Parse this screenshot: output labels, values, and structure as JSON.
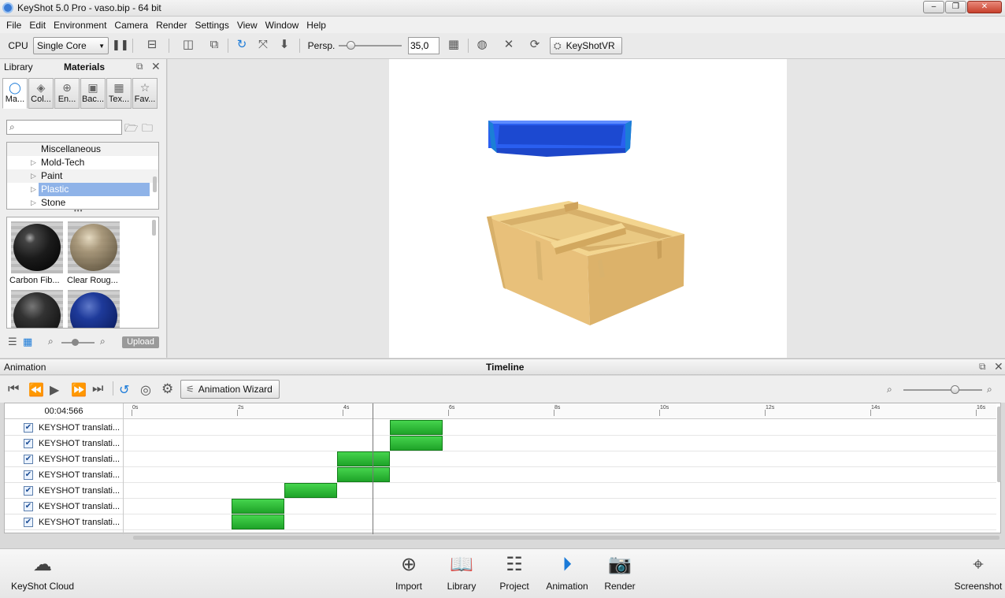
{
  "window": {
    "title": "KeyShot 5.0 Pro  - vaso.bip  - 64 bit",
    "minimize": "–",
    "maximize": "❐",
    "close": "✕"
  },
  "menu": [
    "File",
    "Edit",
    "Environment",
    "Camera",
    "Render",
    "Settings",
    "View",
    "Window",
    "Help"
  ],
  "toolbar": {
    "cpu_label": "CPU",
    "cpu_mode": "Single Core",
    "pause": "❚❚",
    "persp_label": "Persp.",
    "focal_value": "35,0",
    "vr_label": "KeyShotVR"
  },
  "library": {
    "header_left": "Library",
    "header_title": "Materials",
    "tabs": [
      {
        "label": "Ma...",
        "icon": "◯"
      },
      {
        "label": "Col...",
        "icon": "◈"
      },
      {
        "label": "En...",
        "icon": "⊕"
      },
      {
        "label": "Bac...",
        "icon": "▣"
      },
      {
        "label": "Tex...",
        "icon": "▦"
      },
      {
        "label": "Fav...",
        "icon": "☆"
      }
    ],
    "tree": [
      {
        "label": "Miscellaneous",
        "arrow": ""
      },
      {
        "label": "Mold-Tech",
        "arrow": "▷"
      },
      {
        "label": "Paint",
        "arrow": "▷"
      },
      {
        "label": "Plastic",
        "arrow": "▷"
      },
      {
        "label": "Stone",
        "arrow": "▷"
      }
    ],
    "dots": "•••",
    "thumbs": [
      {
        "label": "Carbon Fib...",
        "color": "#1b1b1b"
      },
      {
        "label": "Clear Roug...",
        "color": "#8a7a5a"
      },
      {
        "label": "",
        "color": "#2a2a2a"
      },
      {
        "label": "",
        "color": "#10246e"
      }
    ],
    "upload": "Upload"
  },
  "animation": {
    "header_left": "Animation",
    "header_title": "Timeline",
    "wizard": "Animation Wizard",
    "timecode": "00:04:566",
    "ticks": [
      "0s",
      "2s",
      "4s",
      "6s",
      "8s",
      "10s",
      "12s",
      "14s",
      "16s"
    ],
    "tracks": [
      {
        "name": "KEYSHOT translati...",
        "start": 4.9,
        "end": 5.9
      },
      {
        "name": "KEYSHOT translati...",
        "start": 4.9,
        "end": 5.9
      },
      {
        "name": "KEYSHOT translati...",
        "start": 3.9,
        "end": 4.9
      },
      {
        "name": "KEYSHOT translati...",
        "start": 3.9,
        "end": 4.9
      },
      {
        "name": "KEYSHOT translati...",
        "start": 2.9,
        "end": 3.9
      },
      {
        "name": "KEYSHOT translati...",
        "start": 1.9,
        "end": 2.9
      },
      {
        "name": "KEYSHOT translati...",
        "start": 1.9,
        "end": 2.9
      }
    ],
    "playhead": 4.566
  },
  "bottom": {
    "cloud": "KeyShot Cloud",
    "import": "Import",
    "library": "Library",
    "project": "Project",
    "animation": "Animation",
    "render": "Render",
    "screenshot": "Screenshot"
  },
  "colors": {
    "accent": "#1a7ad8",
    "keyframe": "#2fbe38",
    "selection": "#8fb3e8"
  }
}
